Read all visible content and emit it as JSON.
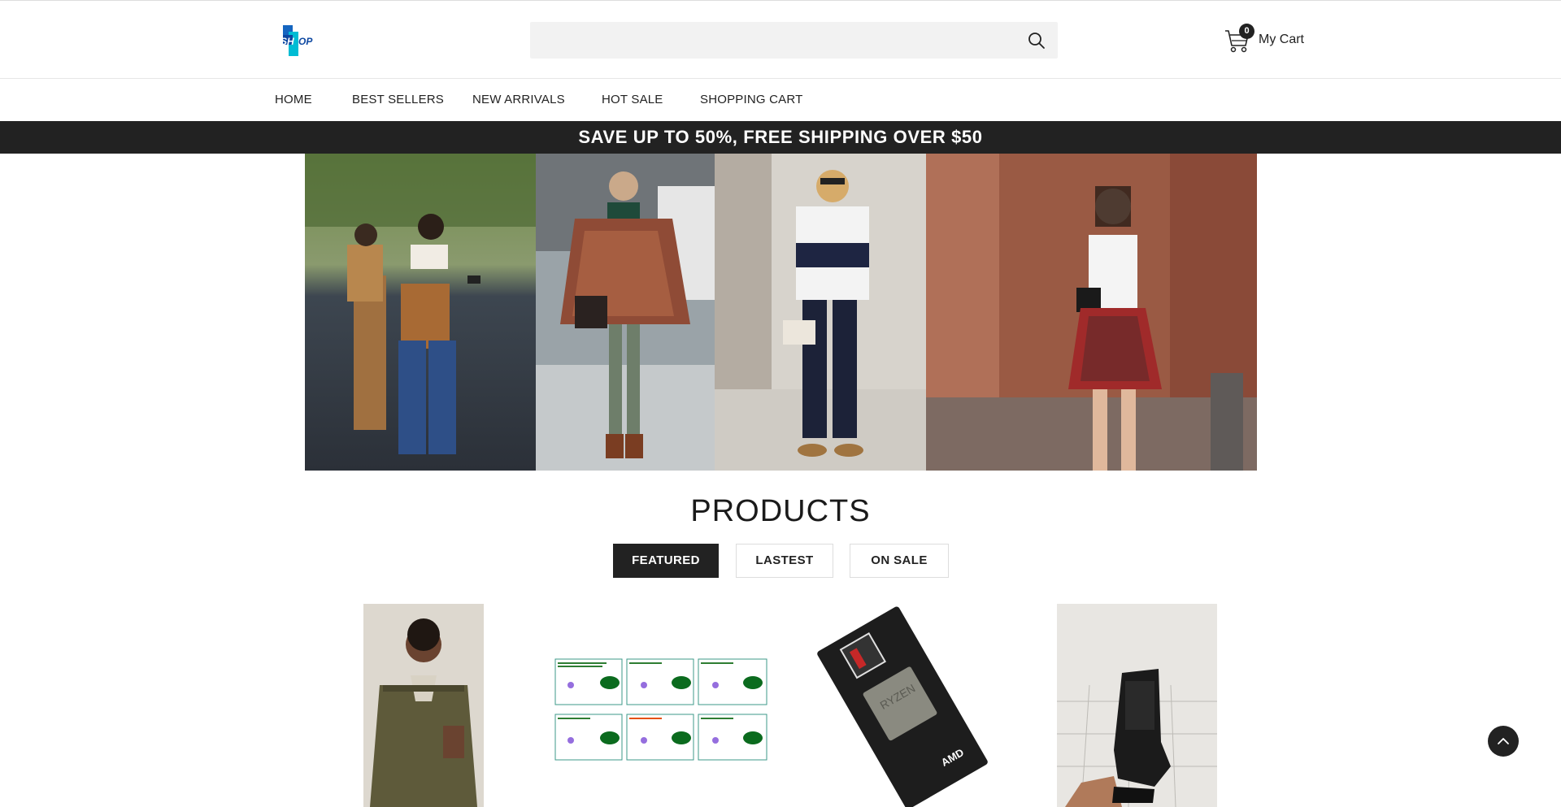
{
  "header": {
    "logo_text": "SHOP",
    "search": {
      "placeholder": "",
      "value": ""
    },
    "cart": {
      "count": "0",
      "label": "My Cart"
    }
  },
  "nav": {
    "items": [
      {
        "label": "HOME"
      },
      {
        "label": "BEST SELLERS"
      },
      {
        "label": "NEW ARRIVALS"
      },
      {
        "label": "HOT SALE"
      },
      {
        "label": "SHOPPING CART"
      }
    ]
  },
  "promo": {
    "text": "SAVE UP TO 50%, FREE SHIPPING OVER $50"
  },
  "products": {
    "title": "PRODUCTS",
    "tabs": [
      {
        "label": "FEATURED",
        "active": true
      },
      {
        "label": "LASTEST",
        "active": false
      },
      {
        "label": "ON SALE",
        "active": false
      }
    ],
    "items": [
      {
        "image": "man-in-olive-jacket-photo"
      },
      {
        "image": "stick-figure-worksheet-cards"
      },
      {
        "image": "amd-ryzen-processor-box"
      },
      {
        "image": "black-tactical-boot-photo"
      }
    ]
  },
  "colors": {
    "accent_dark": "#222222",
    "logo_blue": "#1565c0",
    "logo_cyan": "#00bcd4"
  }
}
